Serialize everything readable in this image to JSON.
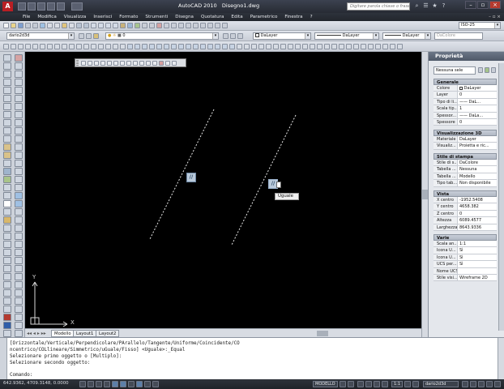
{
  "app": {
    "title": "AutoCAD 2010",
    "drawing_name": "Disegno1.dwg",
    "logo": "A",
    "search_placeholder": "Digitare parola chiave o frase"
  },
  "menu": [
    "File",
    "Modifica",
    "Visualizza",
    "Inserisci",
    "Formato",
    "Strumenti",
    "Disegna",
    "Quotatura",
    "Edita",
    "Parametrico",
    "Finestra",
    "?"
  ],
  "toolbar": {
    "dimstyle_value": "ISO-25",
    "workspace_value": "dario2d3d",
    "layer_value": "0",
    "color_value": "DaLayer",
    "linetype_value": "DaLayer",
    "lineweight_value": "DaLayer",
    "plotstyle_value": "DaColore"
  },
  "tabs": [
    "Modello",
    "Layout1",
    "Layout2"
  ],
  "canvas": {
    "ucs_x_label": "X",
    "ucs_y_label": "Y",
    "glyph_label": "//",
    "tooltip_text": "Uguale"
  },
  "properties": {
    "title": "Proprietà",
    "selection": "Nessuna sele",
    "sections": [
      {
        "title": "Generale",
        "rows": [
          {
            "k": "Colore",
            "v": "DaLayer"
          },
          {
            "k": "Layer",
            "v": "0"
          },
          {
            "k": "Tipo di li...",
            "v": "—— DaL..."
          },
          {
            "k": "Scala tip...",
            "v": "1"
          },
          {
            "k": "Spessor...",
            "v": "—— DaLa..."
          },
          {
            "k": "Spessore",
            "v": "0"
          }
        ]
      },
      {
        "title": "Visualizzazione 3D",
        "rows": [
          {
            "k": "Materiale",
            "v": "DaLayer"
          },
          {
            "k": "Visualiz...",
            "v": "Proietta e ric..."
          }
        ]
      },
      {
        "title": "Stile di stampa",
        "rows": [
          {
            "k": "Stile di s...",
            "v": "DaColore"
          },
          {
            "k": "Tabella ...",
            "v": "Nessuna"
          },
          {
            "k": "Tabella ...",
            "v": "Modello"
          },
          {
            "k": "Tipo tab...",
            "v": "Non disponibile"
          }
        ]
      },
      {
        "title": "Vista",
        "rows": [
          {
            "k": "X centro",
            "v": "-1952.5408"
          },
          {
            "k": "Y centro",
            "v": "4658.382"
          },
          {
            "k": "Z centro",
            "v": "0"
          },
          {
            "k": "Altezza",
            "v": "6089.4577"
          },
          {
            "k": "Larghezza",
            "v": "8643.9336"
          }
        ]
      },
      {
        "title": "Varie",
        "rows": [
          {
            "k": "Scala an...",
            "v": "1:1"
          },
          {
            "k": "Icona U...",
            "v": "Sì"
          },
          {
            "k": "Icona U...",
            "v": "Sì"
          },
          {
            "k": "UCS per...",
            "v": "Sì"
          },
          {
            "k": "Nome UCS",
            "v": ""
          },
          {
            "k": "Stile visi...",
            "v": "Wireframe 2D"
          }
        ]
      }
    ]
  },
  "command": {
    "lines": [
      "[Orizzontale/Verticale/Perpendicolare/PArallelo/Tangente/Uniforme/Coincidente/CO",
      "ncentrico/COLlineare/Simmetrico/uGuale/Fisso] <Uguale>:_Equal",
      "Selezionare primo oggetto o [Multiplo]:",
      "Selezionare secondo oggetto:"
    ],
    "prompt": "Comando:"
  },
  "status": {
    "coords": "642.9362, 4709.3148, 0.0000",
    "model_label": "MODELLO",
    "scale_label": "1:1",
    "workspace_label": "dario2d3d"
  }
}
